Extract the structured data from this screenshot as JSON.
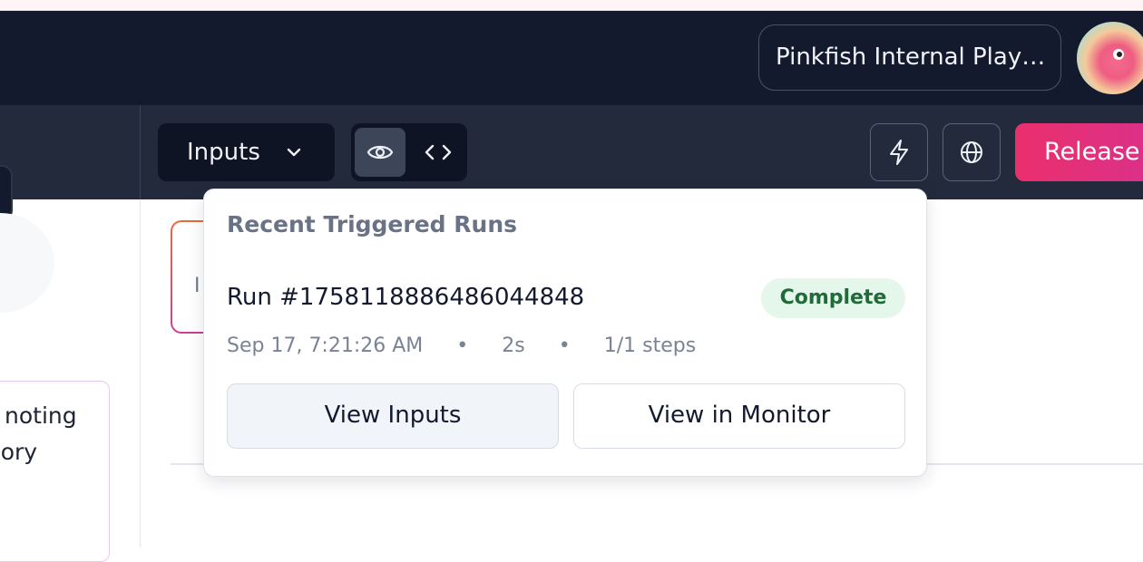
{
  "header": {
    "workspace_name": "Pinkfish Internal Play…",
    "avatar_icon": "pink-fish-avatar"
  },
  "toolbar": {
    "inputs_label": "Inputs",
    "view_modes": [
      "eye-icon",
      "code-icon"
    ],
    "active_view": "eye-icon",
    "trigger_icon": "lightning-icon",
    "globe_icon": "globe-icon",
    "release_label": "Release"
  },
  "background": {
    "left_card_lines": [
      "noting",
      "emory"
    ],
    "mid_card_fragment": "I"
  },
  "popover": {
    "title": "Recent Triggered Runs",
    "run": {
      "id": "Run #1758118886486044848",
      "status": "Complete",
      "timestamp": "Sep 17, 7:21:26 AM",
      "duration": "2s",
      "steps": "1/1 steps",
      "separator": "•"
    },
    "view_inputs_label": "View Inputs",
    "view_monitor_label": "View in Monitor"
  },
  "colors": {
    "header_bg": "#141a2e",
    "toolbar_bg": "#222a3b",
    "release_gradient_start": "#ea2f6c",
    "release_gradient_end": "#d8318f",
    "status_bg": "#e4f7ea",
    "status_text": "#216b3a"
  }
}
